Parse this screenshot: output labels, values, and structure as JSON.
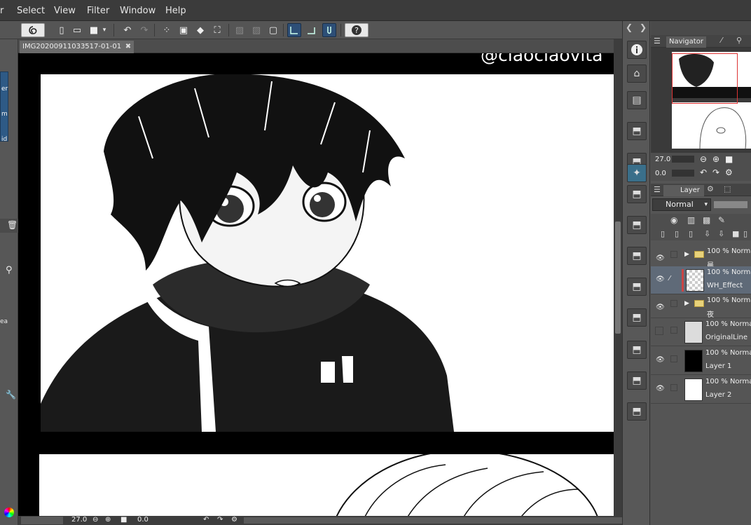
{
  "menu": [
    "r",
    "Select",
    "View",
    "Filter",
    "Window",
    "Help"
  ],
  "document": {
    "tab_title": "IMG20200911033517-01-01",
    "close_glyph": "✖",
    "watermark": "@ciaociaovita"
  },
  "status": {
    "zoom": "27.0",
    "rotation": "0.0"
  },
  "navigator": {
    "tab_label": "Navigator",
    "zoom": "27.0",
    "rotation": "0.0"
  },
  "layer_panel": {
    "tab_label": "Layer",
    "blend_mode": "Normal",
    "layers": [
      {
        "mode": "100 % Norma",
        "name": "晨",
        "type": "folder",
        "visible": true,
        "selected": false,
        "thumb_color": "#ffffff"
      },
      {
        "mode": "100 % Norma",
        "name": "WH_Effect",
        "type": "raster",
        "visible": true,
        "selected": true,
        "thumb_color": "#e9e9e9"
      },
      {
        "mode": "100 % Norma",
        "name": "夜",
        "type": "folder",
        "visible": true,
        "selected": false,
        "thumb_color": "#ffffff"
      },
      {
        "mode": "100 % Normal",
        "name": "OriginalLine",
        "type": "raster",
        "visible": false,
        "selected": false,
        "thumb_color": "#dcdcdc"
      },
      {
        "mode": "100 % Normal",
        "name": "Layer 1",
        "type": "raster",
        "visible": true,
        "selected": false,
        "thumb_color": "#000000"
      },
      {
        "mode": "100 % Normal",
        "name": "Layer 2",
        "type": "raster",
        "visible": true,
        "selected": false,
        "thumb_color": "#ffffff"
      }
    ]
  },
  "left_tool_labels": [
    "er",
    "m",
    "id",
    "ea"
  ],
  "icons": {
    "eye": "eye-icon",
    "info": "info-icon",
    "help": "help-icon"
  }
}
